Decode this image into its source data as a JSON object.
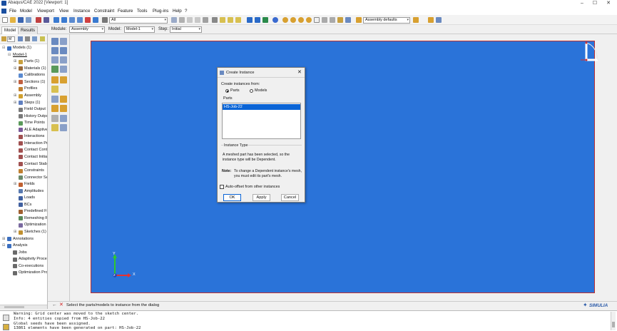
{
  "window": {
    "title": "Abaqus/CAE 2022 [Viewport: 1]",
    "minimize": "–",
    "maximize": "☐",
    "close": "✕"
  },
  "menu": [
    "File",
    "Model",
    "Viewport",
    "View",
    "Instance",
    "Constraint",
    "Feature",
    "Tools",
    "Plug-ins",
    "Help",
    "?"
  ],
  "toolbar": {
    "selection_filter": "All",
    "assembly_defaults": "Assembly defaults"
  },
  "tabs": [
    "Model",
    "Results"
  ],
  "context": {
    "module_label": "Module:",
    "module_value": "Assembly",
    "model_label": "Model:",
    "model_value": "Model-1",
    "step_label": "Step:",
    "step_value": "Initial"
  },
  "tree_filter": "M",
  "tree": [
    {
      "label": "Models (1)",
      "indent": 0,
      "exp": "⊟",
      "icon": "models-icon",
      "color": "#3b6fc0"
    },
    {
      "label": "Model-1",
      "indent": 1,
      "exp": "⊟",
      "icon": "",
      "color": ""
    },
    {
      "label": "Parts (1)",
      "indent": 2,
      "exp": "⊞",
      "icon": "parts-icon",
      "color": "#c8a040"
    },
    {
      "label": "Materials (1)",
      "indent": 2,
      "exp": "⊞",
      "icon": "materials-icon",
      "color": "#9a6a3a"
    },
    {
      "label": "Calibrations",
      "indent": 2,
      "exp": "",
      "icon": "calibrations-icon",
      "color": "#5a8ad0"
    },
    {
      "label": "Sections (1)",
      "indent": 2,
      "exp": "⊞",
      "icon": "sections-icon",
      "color": "#c06040"
    },
    {
      "label": "Profiles",
      "indent": 2,
      "exp": "",
      "icon": "profiles-icon",
      "color": "#c08030"
    },
    {
      "label": "Assembly",
      "indent": 2,
      "exp": "⊞",
      "icon": "assembly-icon",
      "color": "#d0a030"
    },
    {
      "label": "Steps (1)",
      "indent": 2,
      "exp": "⊞",
      "icon": "steps-icon",
      "color": "#6080c0"
    },
    {
      "label": "Field Output Requests",
      "indent": 2,
      "exp": "",
      "icon": "field-output-icon",
      "color": "#7a7a7a"
    },
    {
      "label": "History Output Requests",
      "indent": 2,
      "exp": "",
      "icon": "history-output-icon",
      "color": "#7a7a7a"
    },
    {
      "label": "Time Points",
      "indent": 2,
      "exp": "",
      "icon": "time-points-icon",
      "color": "#5a9a5a"
    },
    {
      "label": "ALE Adaptive Mesh Constraints",
      "indent": 2,
      "exp": "",
      "icon": "ale-icon",
      "color": "#7a5a9a"
    },
    {
      "label": "Interactions",
      "indent": 2,
      "exp": "",
      "icon": "interactions-icon",
      "color": "#a05050"
    },
    {
      "label": "Interaction Properties",
      "indent": 2,
      "exp": "",
      "icon": "interaction-properties-icon",
      "color": "#a05050"
    },
    {
      "label": "Contact Controls",
      "indent": 2,
      "exp": "",
      "icon": "contact-controls-icon",
      "color": "#a05050"
    },
    {
      "label": "Contact Initializations",
      "indent": 2,
      "exp": "",
      "icon": "contact-init-icon",
      "color": "#a05050"
    },
    {
      "label": "Contact Stabilizations",
      "indent": 2,
      "exp": "",
      "icon": "contact-stab-icon",
      "color": "#a05050"
    },
    {
      "label": "Constraints",
      "indent": 2,
      "exp": "",
      "icon": "constraints-icon",
      "color": "#c08030"
    },
    {
      "label": "Connector Sections",
      "indent": 2,
      "exp": "",
      "icon": "connector-icon",
      "color": "#6a8a6a"
    },
    {
      "label": "Fields",
      "indent": 2,
      "exp": "⊞",
      "icon": "fields-icon",
      "color": "#c06030"
    },
    {
      "label": "Amplitudes",
      "indent": 2,
      "exp": "",
      "icon": "amplitudes-icon",
      "color": "#5a7ab0"
    },
    {
      "label": "Loads",
      "indent": 2,
      "exp": "",
      "icon": "loads-icon",
      "color": "#4060a0"
    },
    {
      "label": "BCs",
      "indent": 2,
      "exp": "",
      "icon": "bcs-icon",
      "color": "#4060a0"
    },
    {
      "label": "Predefined Fields",
      "indent": 2,
      "exp": "",
      "icon": "predefined-icon",
      "color": "#a06030"
    },
    {
      "label": "Remeshing Rules",
      "indent": 2,
      "exp": "",
      "icon": "remeshing-icon",
      "color": "#5a8a5a"
    },
    {
      "label": "Optimization Tasks",
      "indent": 2,
      "exp": "",
      "icon": "optimization-icon",
      "color": "#7a6aa0"
    },
    {
      "label": "Sketches (1)",
      "indent": 2,
      "exp": "⊞",
      "icon": "sketches-icon",
      "color": "#c09030"
    },
    {
      "label": "Annotations",
      "indent": 0,
      "exp": "⊞",
      "icon": "annotations-icon",
      "color": "#3b6fc0"
    },
    {
      "label": "Analysis",
      "indent": 0,
      "exp": "⊟",
      "icon": "analysis-icon",
      "color": "#3b6fc0"
    },
    {
      "label": "Jobs",
      "indent": 1,
      "exp": "",
      "icon": "jobs-icon",
      "color": "#6a6a6a"
    },
    {
      "label": "Adaptivity Processes",
      "indent": 1,
      "exp": "",
      "icon": "adaptivity-icon",
      "color": "#6a6a6a"
    },
    {
      "label": "Co-executions",
      "indent": 1,
      "exp": "",
      "icon": "co-executions-icon",
      "color": "#6a6a6a"
    },
    {
      "label": "Optimization Processes",
      "indent": 1,
      "exp": "",
      "icon": "optimization-processes-icon",
      "color": "#6a6a6a"
    }
  ],
  "dialog": {
    "title": "Create Instance",
    "create_from_label": "Create instances from:",
    "option_parts": "Parts",
    "option_models": "Models",
    "selected_option": "Parts",
    "parts_label": "Parts",
    "parts_list": [
      "HS-Job-22"
    ],
    "instance_type_label": "Instance Type",
    "instance_type_text": "A meshed part has been selected, so the instance type will be Dependent.",
    "note_label": "Note:",
    "note_text": "To change a Dependent instance's mesh, you must edit its part's mesh.",
    "auto_offset_label": "Auto-offset from other instances",
    "auto_offset_checked": false,
    "ok": "OK",
    "apply": "Apply",
    "cancel": "Cancel"
  },
  "triad": {
    "x": "X",
    "y": "Y",
    "z": "Z"
  },
  "prompt": "Select the parts/models to instance from the dialog",
  "brand": "SIMULIA",
  "messages": [
    "Warning: Grid center was moved to the sketch center.",
    "Info: 4 entities copied from HS-Job-22",
    "Global seeds have been assigned.",
    "13861 elements have been generated on part: HS-Job-22"
  ],
  "colors": {
    "viewport_bg": "#2a73d9",
    "viewport_border": "#c03030",
    "selection_blue": "#0a64d6"
  }
}
